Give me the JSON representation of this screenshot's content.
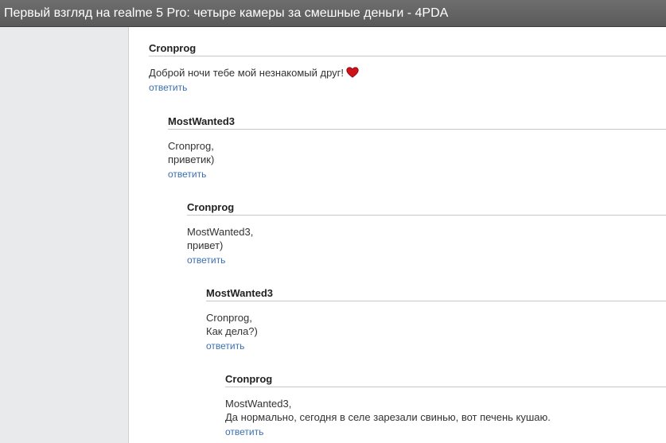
{
  "window": {
    "title": "Первый взгляд на realme 5 Pro: четыре камеры за смешные деньги - 4PDA"
  },
  "comments": [
    {
      "author": "Cronprog",
      "lines": [
        "Доброй ночи тебе мой незнакомый друг!"
      ],
      "emoji": "heart-icon",
      "reply_label": "ответить"
    },
    {
      "author": "MostWanted3",
      "lines": [
        "Cronprog,",
        "приветик)"
      ],
      "reply_label": "ответить"
    },
    {
      "author": "Cronprog",
      "lines": [
        "MostWanted3,",
        "привет)"
      ],
      "reply_label": "ответить"
    },
    {
      "author": "MostWanted3",
      "lines": [
        "Cronprog,",
        "Как дела?)"
      ],
      "reply_label": "ответить"
    },
    {
      "author": "Cronprog",
      "lines": [
        "MostWanted3,",
        "Да нормально, сегодня в селе зарезали свинью, вот печень кушаю."
      ],
      "reply_label": "ответить"
    }
  ],
  "colors": {
    "link": "#3a6fb0",
    "titlebar": "#5f5f5f",
    "sidebar": "#e9eaeb",
    "heart": "#d0101a"
  }
}
